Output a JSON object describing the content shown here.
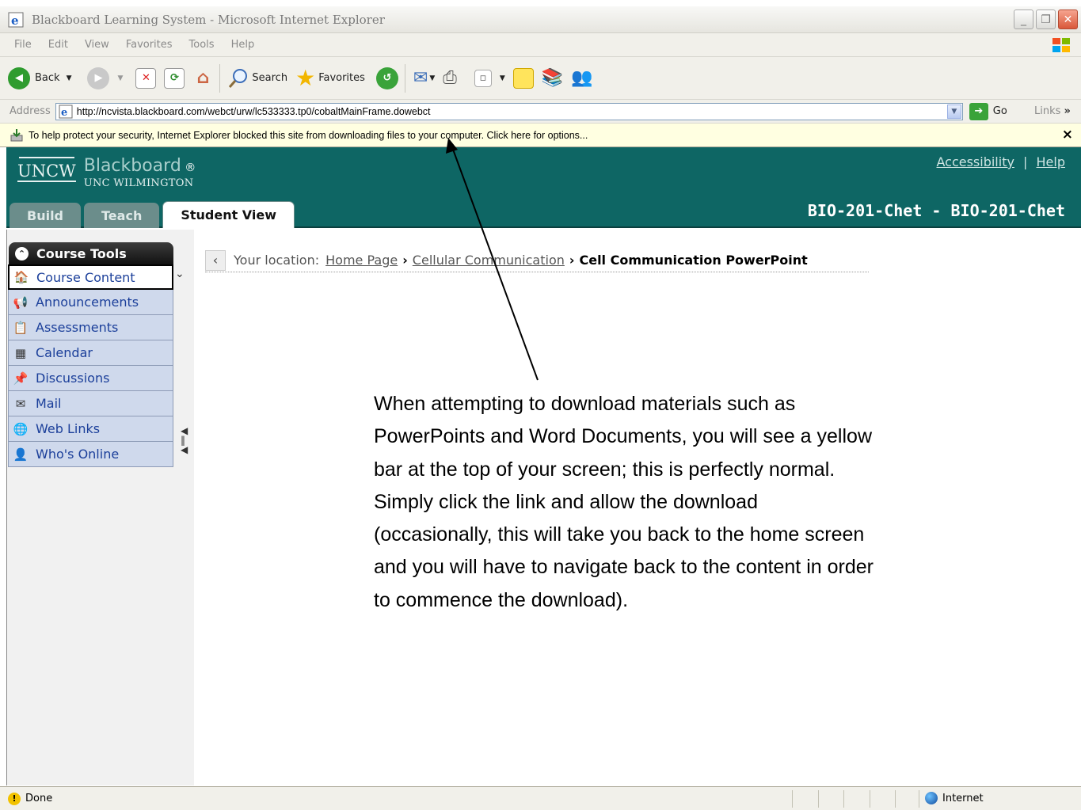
{
  "window": {
    "title": "Blackboard Learning System - Microsoft Internet Explorer"
  },
  "menu": [
    "File",
    "Edit",
    "View",
    "Favorites",
    "Tools",
    "Help"
  ],
  "toolbar": {
    "back_label": "Back",
    "search_label": "Search",
    "favorites_label": "Favorites"
  },
  "address": {
    "label": "Address",
    "url": "http://ncvista.blackboard.com/webct/urw/lc533333.tp0/cobaltMainFrame.dowebct",
    "go_label": "Go",
    "links_label": "Links"
  },
  "infobar": {
    "message": "To help protect your security, Internet Explorer blocked this site from downloading files to your computer. Click here for options...",
    "close": "×"
  },
  "header": {
    "logo_text": "UNCW",
    "brand": "Blackboard",
    "brand_sub": "UNC WILMINGTON",
    "accessibility": "Accessibility",
    "separator": "|",
    "help": "Help",
    "course_title": "BIO-201-Chet - BIO-201-Chet",
    "tabs": [
      {
        "label": "Build"
      },
      {
        "label": "Teach"
      },
      {
        "label": "Student View"
      }
    ]
  },
  "course_tools": {
    "title": "Course Tools",
    "items": [
      {
        "label": "Course Content",
        "icon": "home-icon"
      },
      {
        "label": "Announcements",
        "icon": "megaphone-icon"
      },
      {
        "label": "Assessments",
        "icon": "clipboard-icon"
      },
      {
        "label": "Calendar",
        "icon": "calendar-icon"
      },
      {
        "label": "Discussions",
        "icon": "pin-icon"
      },
      {
        "label": "Mail",
        "icon": "mail-icon"
      },
      {
        "label": "Web Links",
        "icon": "globe-icon"
      },
      {
        "label": "Who's Online",
        "icon": "person-icon"
      }
    ]
  },
  "breadcrumb": {
    "prefix": "Your location:",
    "home": "Home Page",
    "section": "Cellular Communication",
    "current": "Cell Communication PowerPoint"
  },
  "annotation": {
    "text": "When attempting to download materials such as PowerPoints and Word Documents, you will see a yellow bar at the top of your screen; this is perfectly normal.  Simply click the link and allow the download (occasionally, this will take you back to the home screen and you will have to navigate back to the content in order to commence the download)."
  },
  "status": {
    "text": "Done",
    "zone": "Internet"
  }
}
